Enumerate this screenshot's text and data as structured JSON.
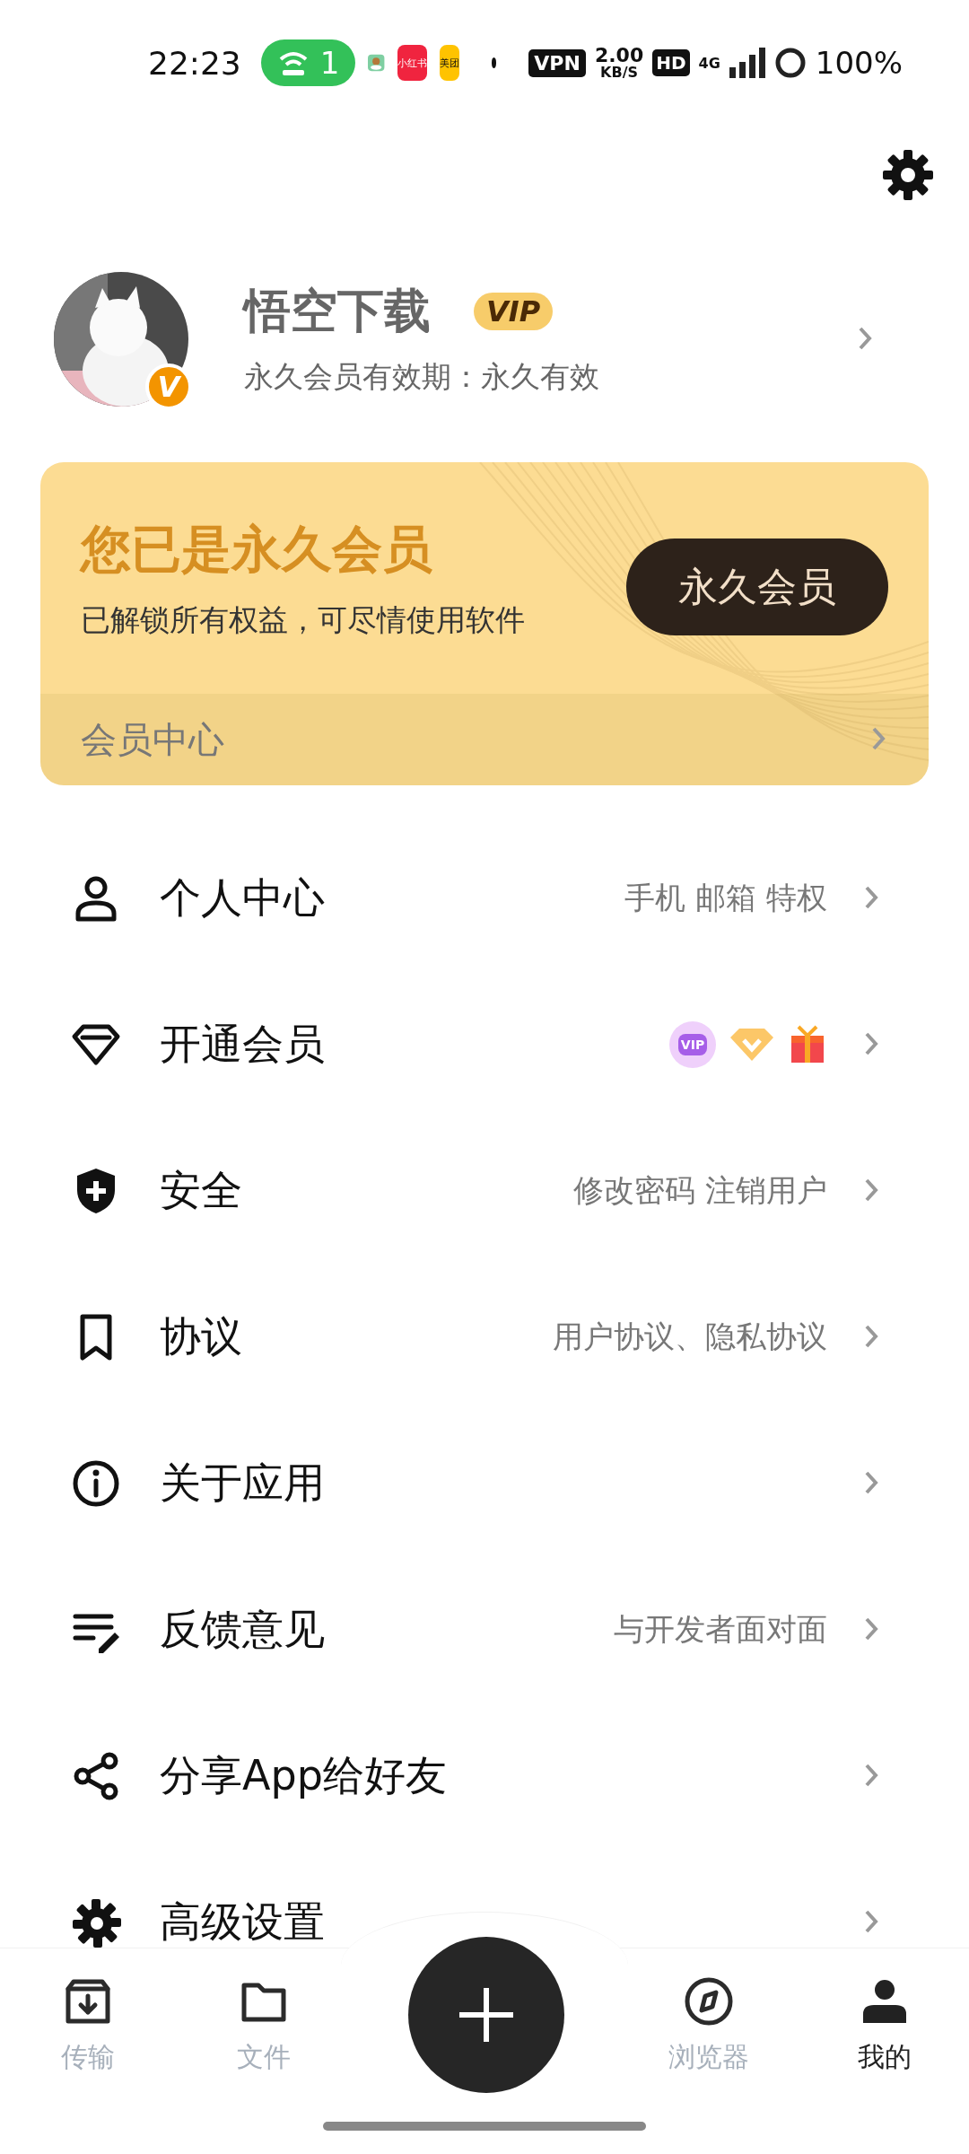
{
  "status_bar": {
    "time": "22:23",
    "hotspot_count": "1",
    "apps": [
      {
        "kind": "picture"
      },
      {
        "kind": "text",
        "text": "小红书"
      },
      {
        "kind": "text",
        "text": "美团"
      }
    ],
    "vpn": "VPN",
    "speed": "2.00",
    "speed_unit": "KB/S",
    "hd": "HD",
    "network": "4G",
    "battery": "100%"
  },
  "profile": {
    "name": "悟空下载",
    "vip_badge": "VIP",
    "avatar_badge": "V",
    "subtitle": "永久会员有效期：永久有效"
  },
  "member_card": {
    "title": "您已是永久会员",
    "subtitle": "已解锁所有权益，可尽情使用软件",
    "button": "永久会员",
    "footer": "会员中心"
  },
  "menu": [
    {
      "kind": "text",
      "label": "个人中心",
      "detail": "手机 邮箱 特权"
    },
    {
      "kind": "badges",
      "label": "开通会员",
      "badge_text": "VIP"
    },
    {
      "kind": "text",
      "label": "安全",
      "detail": "修改密码  注销用户"
    },
    {
      "kind": "text",
      "label": "协议",
      "detail": "用户协议、隐私协议"
    },
    {
      "kind": "text",
      "label": "关于应用"
    },
    {
      "kind": "text",
      "label": "反馈意见",
      "detail": "与开发者面对面"
    },
    {
      "kind": "text",
      "label": "分享App给好友"
    },
    {
      "kind": "text",
      "label": "高级设置"
    }
  ],
  "bottom_nav": [
    {
      "label": "传输",
      "selected": false
    },
    {
      "label": "文件",
      "selected": false
    },
    {
      "label": "浏览器",
      "selected": false
    },
    {
      "label": "我的",
      "selected": true
    }
  ]
}
